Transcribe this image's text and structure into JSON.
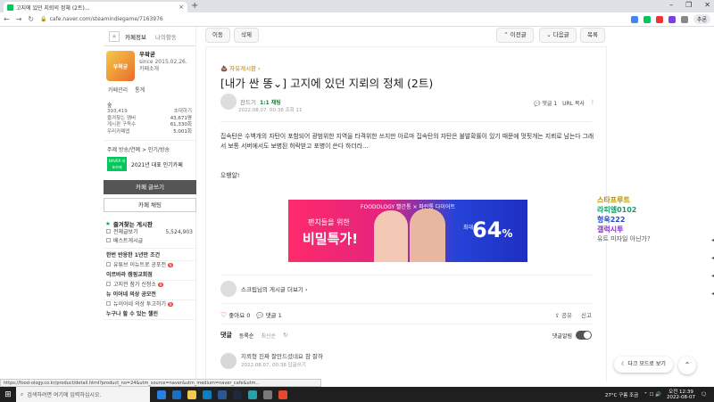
{
  "browser": {
    "tab_title": "고지에 있던 지뢰의 정체 (2트)...",
    "tab_close": "×",
    "newtab": "+",
    "win_controls": [
      "–",
      "❐",
      "✕"
    ],
    "url": "cafe.naver.com/steamindiegame/7163976",
    "profile": "추론"
  },
  "sidebar": {
    "tab_info": "카페정보",
    "tab_activity": "나의활동",
    "cafe_logo_text": "우왁굳",
    "manager": "우왁굳",
    "since": "since 2015.02.26.",
    "intro": "카페소개",
    "link_manage": "카페관리",
    "link_stats": "통계",
    "rank": "숲",
    "members": "393,419",
    "invite": "초대하기",
    "stats": [
      {
        "k": "즐겨찾는 멤버",
        "v": "43,671명"
      },
      {
        "k": "게시판 구독수",
        "v": "61,330회"
      },
      {
        "k": "우리카페앱",
        "v": "5,001회"
      }
    ],
    "subject": "주제 방송/연예 > 인기/방송",
    "naver_badge": "NAVER 대표카페",
    "naver_text": "2021년 대표 인기카페",
    "write_btn": "카페 글쓰기",
    "chat_btn": "카페 채팅",
    "fav_section": "즐겨찾는 게시판",
    "fav_items": [
      {
        "label": "전체글보기",
        "count": "5,524,903"
      },
      {
        "label": "베스트게시글",
        "count": ""
      }
    ],
    "groups": [
      {
        "label": "한번 반응한 1년만 조건",
        "bold": true,
        "new": false
      },
      {
        "label": "유튜브 이뉴트로 공포전",
        "bold": false,
        "new": true
      },
      {
        "label": "이르바라 캠핑교회점",
        "bold": true,
        "new": false
      },
      {
        "label": "고지전 참가 신청소",
        "bold": false,
        "new": true
      },
      {
        "label": "뉴 이어네 의상 공모전",
        "bold": true,
        "new": false
      },
      {
        "label": "뉴이어네 의상 투고하기",
        "bold": false,
        "new": true
      },
      {
        "label": "누구나 할 수 있는 챌린",
        "bold": true,
        "new": false
      }
    ]
  },
  "actions": {
    "move": "이동",
    "delete": "삭제",
    "prev": "이전글",
    "next": "다음글",
    "list": "목록"
  },
  "post": {
    "board": "자유게시판",
    "title": "[내가 싼 똥⌄] 고지에 있던 지뢰의 정체 (2트)",
    "author": "잔드기",
    "author_badge": "1:1 채팅",
    "date": "2022.08.07. 00:38  조회 11",
    "comments": "댓글 1",
    "copy_url": "URL 복사",
    "body": "집속탄은 수백개의 자탄이 포함되어 광범위한 지역을 타격위한 쓰지만 아르마 집속탄의 자탄은 불발확률이 있기 때문에 멋핏개는 지뢰로 남는다 그래서 보통 서버에서도 보병된 허락받고 포병이 쓴다 하더라...",
    "body2": "오뱅알!",
    "author_line": "스크립님의 게시글 더보기 ›"
  },
  "ad": {
    "top": "FOODOLOGY  빨간통 × 파란통 다이어트",
    "sub": "팬치들을 위한",
    "main": "비밀특가!",
    "max": "최대",
    "pct": "64",
    "pct_sign": "%"
  },
  "reactions": {
    "like": "좋아요 0",
    "comment": "댓글 1",
    "share": "공유",
    "report": "신고"
  },
  "comments": {
    "title": "댓글",
    "sort_reg": "등록순",
    "sort_new": "최신순",
    "alarm": "댓글알림",
    "items": [
      {
        "text": "지뢰형 진짜 잘만드셨네요 참 잘하",
        "meta": "2022.08.07. 00:38  답글쓰기"
      }
    ]
  },
  "chat": [
    {
      "name": "스타프루트",
      "color": "#b38f00"
    },
    {
      "name": "라피엘0102",
      "color": "#1a9b6c"
    },
    {
      "name": "형욱222",
      "color": "#2a4dc7"
    },
    {
      "name": "갤럭시투",
      "color": "#8a2bd6"
    },
    {
      "name": "유트 미자일 아닌가?",
      "color": "#555555"
    }
  ],
  "floating": {
    "darkmode": "다크 모드로 보기",
    "totop": "⌃"
  },
  "status_url": "https://food-ology.co.kr/product/detail.html?product_no=24&utm_source=naver&utm_medium=naver_cafe&utm...",
  "taskbar": {
    "search": "검색하려면 여기에 입력하십시오.",
    "weather": "27°C 구름 조금",
    "time": "오전 12:39",
    "date": "2022-08-07"
  }
}
